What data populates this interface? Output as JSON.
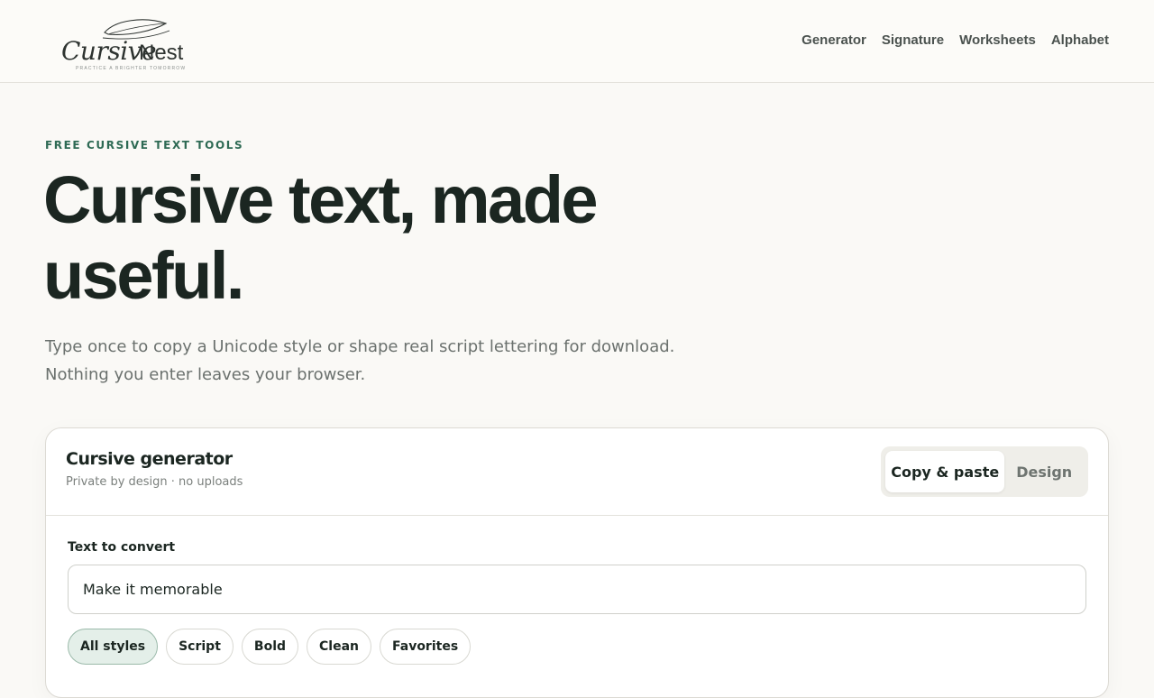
{
  "brand": {
    "logo_script": "Cursive",
    "logo_nest": "Nest",
    "tagline": "PRACTICE A BRIGHTER TOMORROW"
  },
  "nav": {
    "items": [
      "Generator",
      "Signature",
      "Worksheets",
      "Alphabet"
    ]
  },
  "hero": {
    "eyebrow": "FREE CURSIVE TEXT TOOLS",
    "title": "Cursive text, made useful.",
    "subtitle": "Type once to copy a Unicode style or shape real script lettering for download. Nothing you enter leaves your browser."
  },
  "generator": {
    "title": "Cursive generator",
    "note": "Private by design · no uploads",
    "modes": [
      "Copy & paste",
      "Design"
    ],
    "active_mode": "Copy & paste",
    "input_label": "Text to convert",
    "input_value": "Make it memorable",
    "filters": [
      "All styles",
      "Script",
      "Bold",
      "Clean",
      "Favorites"
    ],
    "active_filter": "All styles"
  },
  "colors": {
    "accent": "#2e6a54",
    "ink": "#1b2621",
    "background": "#faf9f6"
  },
  "icons": {
    "logo": "feather-icon"
  }
}
